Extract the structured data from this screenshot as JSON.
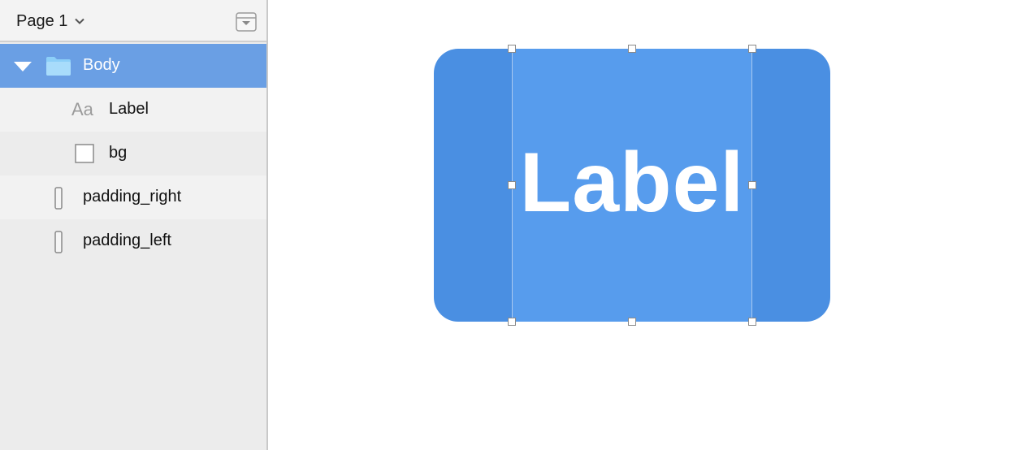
{
  "sidebar": {
    "page_name": "Page 1",
    "layers": [
      {
        "name": "Body",
        "icon": "folder-icon",
        "selected": true
      },
      {
        "name": "Label",
        "icon_text": "Aa"
      },
      {
        "name": "bg",
        "icon": "rectangle-icon"
      },
      {
        "name": "padding_right",
        "icon": "spacer-icon"
      },
      {
        "name": "padding_left",
        "icon": "spacer-icon"
      }
    ]
  },
  "canvas": {
    "button_label": "Label"
  },
  "colors": {
    "selected_row": "#6a9fe4",
    "button_outer": "#4a8fe2",
    "button_inner": "#579ced",
    "folder": "#8ccff8"
  }
}
